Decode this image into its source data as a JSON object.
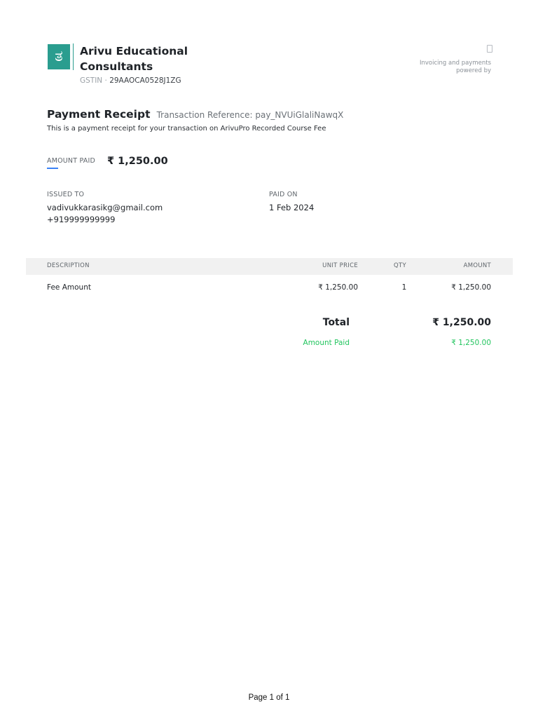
{
  "header": {
    "logo_glyph": "ತ",
    "org_name": "Arivu Educational Consultants",
    "gstin_label": "GSTIN",
    "gstin_separator": " · ",
    "gstin_value": "29AAOCA0528J1ZG",
    "powered_by_text": "Invoicing and payments powered by",
    "brand_color": "#2a9d8f"
  },
  "receipt": {
    "title": "Payment Receipt",
    "transaction_reference": "Transaction Reference: pay_NVUiGlaliNawqX",
    "description": "This is a payment receipt for your transaction on ArivuPro Recorded Course Fee"
  },
  "amount_paid": {
    "label": "AMOUNT PAID",
    "value": "₹ 1,250.00"
  },
  "issued_to": {
    "label": "ISSUED TO",
    "email": "vadivukkarasikg@gmail.com",
    "phone": "+919999999999"
  },
  "paid_on": {
    "label": "PAID ON",
    "date": "1 Feb 2024"
  },
  "table": {
    "headers": {
      "description": "DESCRIPTION",
      "unit_price": "UNIT PRICE",
      "qty": "QTY",
      "amount": "AMOUNT"
    },
    "rows": [
      {
        "description": "Fee Amount",
        "unit_price": "₹ 1,250.00",
        "qty": "1",
        "amount": "₹ 1,250.00"
      }
    ]
  },
  "totals": {
    "total_label": "Total",
    "total_value": "₹ 1,250.00",
    "paid_label": "Amount Paid",
    "paid_value": "₹ 1,250.00",
    "paid_color": "#22c55e"
  },
  "footer": {
    "page_text": "Page 1 of 1"
  }
}
